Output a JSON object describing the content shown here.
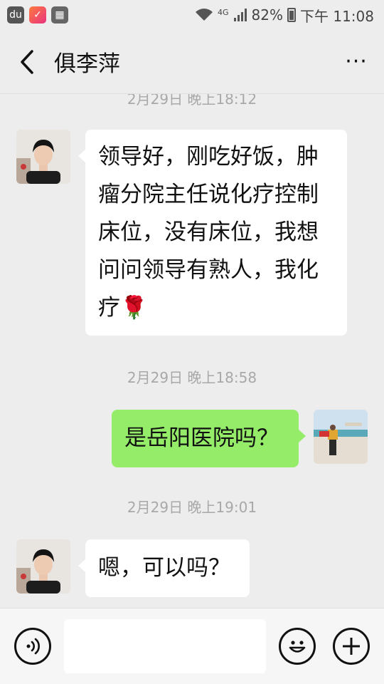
{
  "status_bar": {
    "apps": [
      {
        "icon": "baidu-icon",
        "glyph": "du",
        "color": "#555555"
      },
      {
        "icon": "app-check-icon",
        "glyph": "✓",
        "color": "#ff5a4f"
      },
      {
        "icon": "app-grid-icon",
        "glyph": "▦",
        "color": "#666666"
      }
    ],
    "network": "4G",
    "battery": "82%",
    "time": "下午 11:08"
  },
  "header": {
    "title": "俱李萍",
    "more": "···"
  },
  "messages": [
    {
      "type": "timestamp",
      "text": "2月29日 晚上18:12"
    },
    {
      "type": "incoming",
      "text": "领导好，刚吃好饭，肿瘤分院主任说化疗控制床位，没有床位，我想问问领导有熟人，我化疗",
      "emoji": "🌹"
    },
    {
      "type": "timestamp",
      "text": "2月29日 晚上18:58"
    },
    {
      "type": "outgoing",
      "text": "是岳阳医院吗？"
    },
    {
      "type": "timestamp",
      "text": "2月29日 晚上19:01"
    },
    {
      "type": "incoming",
      "text": "嗯，可以吗？"
    }
  ],
  "colors": {
    "outgoing_bubble": "#95ec69",
    "incoming_bubble": "#ffffff",
    "background": "#ededed"
  }
}
